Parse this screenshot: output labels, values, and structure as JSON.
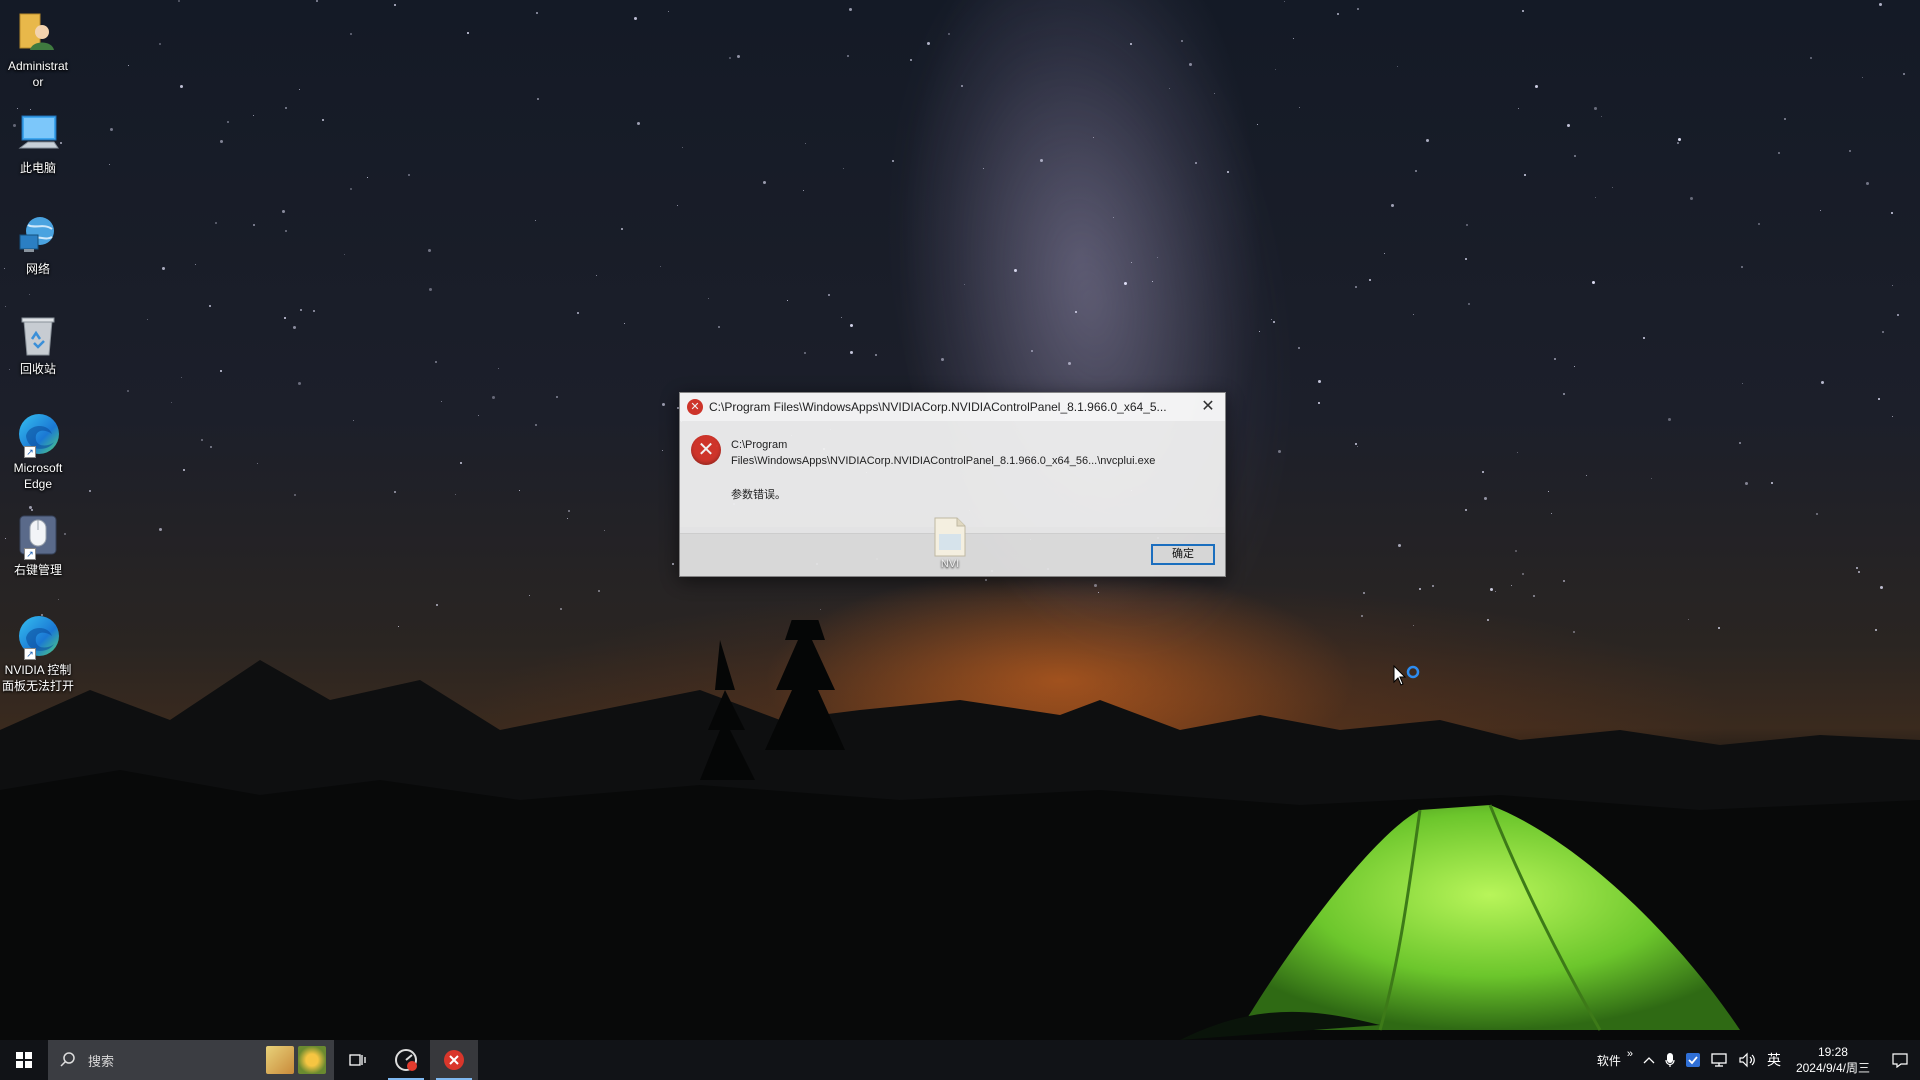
{
  "desktop": {
    "icons": [
      {
        "label": "Administrat or",
        "icon": "user-folder-icon"
      },
      {
        "label": "此电脑",
        "icon": "computer-icon"
      },
      {
        "label": "网络",
        "icon": "network-icon"
      },
      {
        "label": "回收站",
        "icon": "recycle-bin-icon"
      },
      {
        "label": "Microsoft Edge",
        "icon": "edge-icon"
      },
      {
        "label": "右键管理",
        "icon": "mouse-icon"
      },
      {
        "label": "NVIDIA 控制面板无法打开",
        "icon": "edge-icon"
      }
    ]
  },
  "dialog": {
    "title": "C:\\Program Files\\WindowsApps\\NVIDIACorp.NVIDIAControlPanel_8.1.966.0_x64_5...",
    "path_line1": "C:\\Program",
    "path_line2": "Files\\WindowsApps\\NVIDIACorp.NVIDIAControlPanel_8.1.966.0_x64_56...\\nvcplui.exe",
    "message": "参数错误。",
    "ok_label": "确定",
    "close_glyph": "✕",
    "error_glyph": "✕"
  },
  "dragged_file": {
    "label": "NVI"
  },
  "taskbar": {
    "search_placeholder": "搜索",
    "tray": {
      "label": "软件",
      "chevron": "»",
      "ime": "英",
      "time": "19:28",
      "date": "2024/9/4/周三"
    }
  },
  "colors": {
    "error_red": "#d9362b",
    "accent": "#1a73c8",
    "tent_green": "#7bd43a"
  }
}
